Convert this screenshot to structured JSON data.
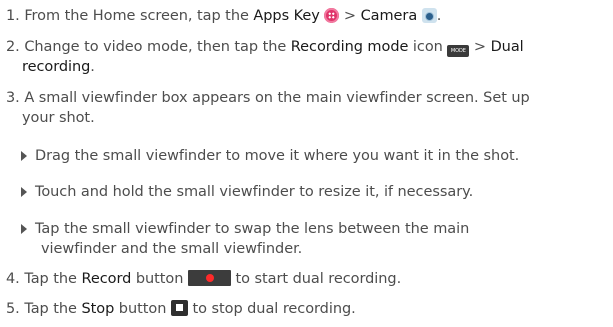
{
  "steps": [
    {
      "num": "1.",
      "t1": "From the Home screen, tap the ",
      "b1": "Apps Key",
      "t2": " > ",
      "b2": "Camera",
      "icon_apps": "apps-key-icon",
      "icon_camera": "camera-icon"
    },
    {
      "num": "2.",
      "t1": "Change to video mode, then tap the ",
      "b1": "Recording mode",
      "t2": " icon ",
      "t3": " > ",
      "b2": "Dual",
      "b3": "recording",
      "t4": ".",
      "icon_mode_text": "MODE",
      "icon_mode": "recording-mode-icon"
    },
    {
      "num": "3.",
      "line1": "A small viewfinder box appears on the main viewfinder screen. Set up",
      "line2": "your shot."
    },
    {
      "num": "4.",
      "t1": "Tap the ",
      "b1": "Record",
      "t2": " button ",
      "t3": " to start dual recording.",
      "icon_record": "record-button-icon"
    },
    {
      "num": "5.",
      "t1": "Tap the ",
      "b1": "Stop",
      "t2": " button ",
      "t3": " to stop dual recording.",
      "icon_stop": "stop-button-icon"
    }
  ],
  "sub_bullets": [
    {
      "line1": "Drag the small viewfinder to move it where you want it in the shot."
    },
    {
      "line1": "Touch and hold the small viewfinder to resize it, if necessary."
    },
    {
      "line1": "Tap the small viewfinder to swap the lens between the main",
      "line2": "viewfinder and the small viewfinder."
    }
  ],
  "colors": {
    "apps_key": "#e0356b",
    "camera": "#2b5f8c",
    "record_dot": "#ff2a2a",
    "button_bg": "#3c3c3c",
    "text": "#4d4d4d",
    "bold_text": "#1a1a1a"
  }
}
